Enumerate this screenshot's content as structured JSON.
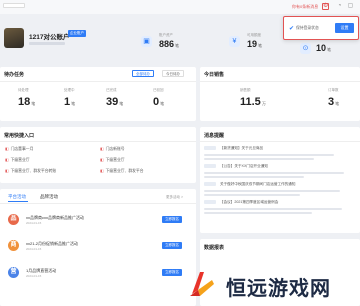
{
  "top_bar": {
    "message_link": "你有0条新消息"
  },
  "profile": {
    "name": "1217对公账户",
    "tag": "企业账户"
  },
  "stats": [
    {
      "label": "账户资产",
      "value": "886",
      "unit": "笔"
    },
    {
      "label": "可用额度",
      "value": "19",
      "unit": "笔"
    },
    {
      "label": "待办",
      "value": "10",
      "unit": "笔"
    }
  ],
  "popover": {
    "label": "保持登录状态",
    "button": "设置"
  },
  "todo": {
    "title": "待办任务",
    "filters": [
      "全部待办",
      "今日待办"
    ],
    "metrics": [
      {
        "label": "待处理",
        "value": "18",
        "unit": "笔"
      },
      {
        "label": "处理中",
        "value": "1",
        "unit": "笔"
      },
      {
        "label": "已完成",
        "value": "39",
        "unit": "笔"
      },
      {
        "label": "已驳回",
        "value": "0",
        "unit": "笔"
      }
    ]
  },
  "today": {
    "title": "今日销售",
    "metrics": [
      {
        "label": "销售额",
        "value": "11.5",
        "unit": "万"
      },
      {
        "label": "订单数",
        "value": "3",
        "unit": "笔"
      }
    ]
  },
  "shortcuts": {
    "title": "常用快捷入口",
    "items": [
      "门店董事一月",
      "门店新账号",
      "下级营业厅",
      "下级营业厅",
      "下级营业厅、群发平台转账",
      "下级营业厅",
      "下级营业厅、群发平台",
      "下级门店服务"
    ]
  },
  "activities": {
    "tabs": [
      "平台活动",
      "品牌活动"
    ],
    "more": "更多活动 >",
    "items": [
      {
        "icon": "品",
        "color": "#e8694a",
        "title": "xx品牌商cxx品牌商新品推广活动",
        "date": "2024-01-15",
        "button": "立即报名"
      },
      {
        "icon": "商",
        "color": "#f0913b",
        "title": "xx21-2月份促销新品推广活动",
        "date": "2024-01-15",
        "button": "立即报名"
      },
      {
        "icon": "营",
        "color": "#4a83e8",
        "title": "1月品牌直营活动",
        "date": "2024-01-15",
        "button": "立即报名"
      }
    ]
  },
  "news": {
    "title": "消息提醒",
    "items": [
      "【新货通知】关于元旦商品",
      "【公告】关于XX门店开业通知",
      "关于做好中秋国庆双节期间门店运营工作的通知",
      "【会议】2021第四季度区域运营例会"
    ]
  },
  "bottom_right": {
    "title": "数据报表"
  },
  "watermark": {
    "text": "恒远游戏网"
  }
}
